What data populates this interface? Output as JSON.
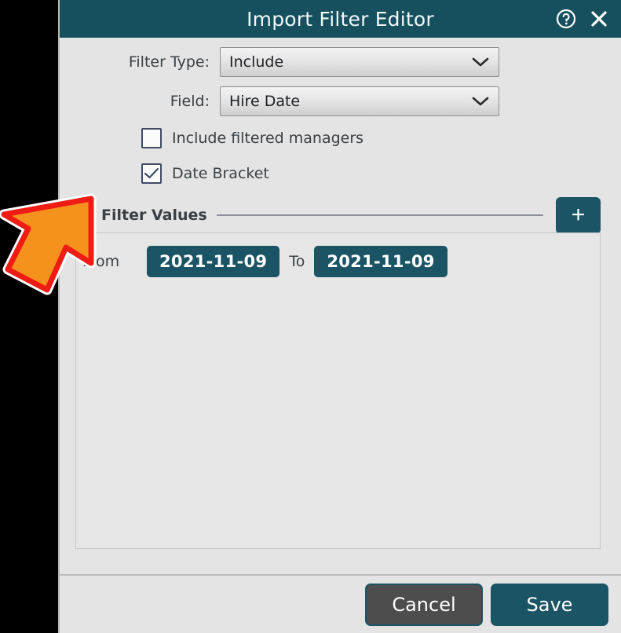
{
  "window": {
    "title": "Import Filter Editor",
    "help_icon": "help-circle-icon",
    "close_icon": "close-icon",
    "titlebar_color": "#16505e",
    "accent_color": "#1b5464",
    "body_color": "#e4e4e4"
  },
  "form": {
    "filter_type": {
      "label": "Filter Type:",
      "value": "Include",
      "chevron": "chevron-down-icon"
    },
    "field": {
      "label": "Field:",
      "value": "Hire Date",
      "chevron": "chevron-down-icon"
    },
    "checkboxes": [
      {
        "label": "Include filtered managers",
        "checked": false
      },
      {
        "label": "Date Bracket",
        "checked": true
      }
    ]
  },
  "filter_values": {
    "group_title": "Filter Values",
    "add_button_label": "+",
    "rows": [
      {
        "from_label": "From",
        "from_value": "2021-11-09",
        "to_label": "To",
        "to_value": "2021-11-09"
      }
    ]
  },
  "footer": {
    "cancel_label": "Cancel",
    "save_label": "Save"
  },
  "annotation": {
    "arrow_fill": "#F5921E",
    "arrow_stroke": "#EE1C14",
    "arrow_halo": "#FFFFFF"
  }
}
